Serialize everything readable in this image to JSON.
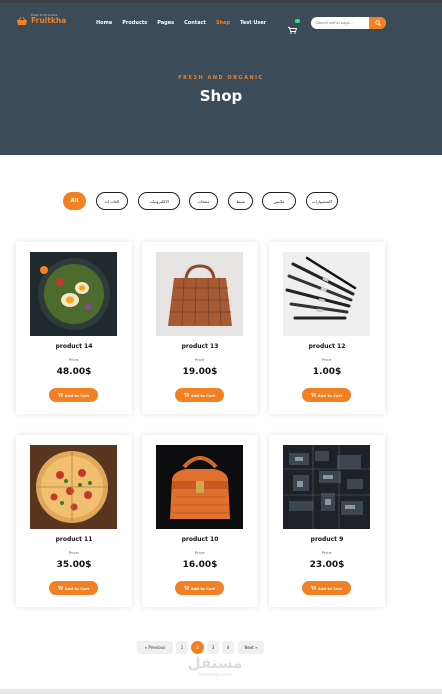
{
  "brand": {
    "name": "Fruitkha",
    "tagline": "Fresh Fruit Online"
  },
  "nav": {
    "items": [
      {
        "label": "Home",
        "active": false
      },
      {
        "label": "Products",
        "active": false
      },
      {
        "label": "Pages",
        "active": false
      },
      {
        "label": "Contact",
        "active": false
      },
      {
        "label": "Shop",
        "active": true
      },
      {
        "label": "Test User",
        "active": false
      }
    ]
  },
  "cart": {
    "icon": "cart-icon",
    "badge": "1"
  },
  "search": {
    "placeholder": "Search within page...",
    "icon": "search-icon"
  },
  "hero": {
    "subtitle": "FRESH AND ORGANIC",
    "title": "Shop"
  },
  "filters": [
    {
      "label": "All",
      "active": true
    },
    {
      "label": "العاب اند",
      "active": false
    },
    {
      "label": "الالكترونيات",
      "active": false
    },
    {
      "label": "منتجات",
      "active": false
    },
    {
      "label": "شنط",
      "active": false
    },
    {
      "label": "ملابس",
      "active": false
    },
    {
      "label": "اكسسوارات",
      "active": false
    }
  ],
  "products": [
    {
      "name": "product 14",
      "price_label": "Price:",
      "price": "48.00$",
      "button": "Add to Cart"
    },
    {
      "name": "product 13",
      "price_label": "Price:",
      "price": "19.00$",
      "button": "Add to Cart"
    },
    {
      "name": "product 12",
      "price_label": "Price:",
      "price": "1.00$",
      "button": "Add to Cart"
    },
    {
      "name": "product 11",
      "price_label": "Price:",
      "price": "35.00$",
      "button": "Add to Cart"
    },
    {
      "name": "product 10",
      "price_label": "Price:",
      "price": "16.00$",
      "button": "Add to Cart"
    },
    {
      "name": "product 9",
      "price_label": "Price:",
      "price": "23.00$",
      "button": "Add to Cart"
    }
  ],
  "pagination": {
    "prev": "« Previous",
    "pages": [
      "1",
      "2",
      "3",
      "4"
    ],
    "current": "2",
    "next": "Next »"
  },
  "watermark": {
    "arabic": "مستقل",
    "latin": "mostaql.com"
  },
  "colors": {
    "accent": "#f28123",
    "hero_bg": "#3b4b57",
    "badge": "#2ecc71"
  }
}
